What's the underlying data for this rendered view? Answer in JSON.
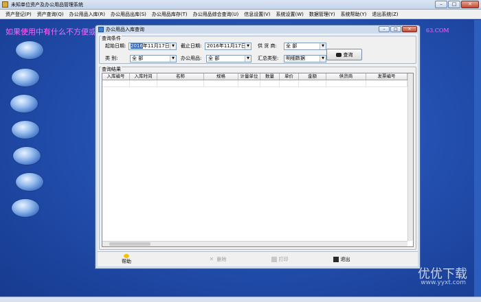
{
  "app": {
    "title": "未知单位资产及办公用品管理系统"
  },
  "window_controls": {
    "minimize": "–",
    "maximize": "□",
    "close": "✕"
  },
  "menu": [
    "资产登记(P)",
    "资产查询(Q)",
    "办公用品入库(R)",
    "办公用品出库(S)",
    "办公用品库存(T)",
    "办公用品综合查询(U)",
    "信息设置(V)",
    "系统设置(W)",
    "数据管理(Y)",
    "系统帮助(Y)",
    "退出系统(Z)"
  ],
  "marquee": {
    "text": "如果使用中有什么不方便或",
    "tail": "63.COM"
  },
  "dialog": {
    "title": "办公用品入库查询",
    "conditions": {
      "group_title": "查询条件",
      "start_date_label": "起始日期:",
      "start_date_sel": "2016",
      "start_date_rest": "年11月17日",
      "end_date_label": "截止日期:",
      "end_date": "2016年11月17日",
      "supplier_label": "供 货 商:",
      "supplier_value": "全    部",
      "category_label": "类    别:",
      "category_value": "全    部",
      "product_label": "办公用品:",
      "product_value": "全    部",
      "summary_label": "汇总类型:",
      "summary_value": "明细数据",
      "query_button": "查询"
    },
    "results": {
      "group_title": "查询结果",
      "columns": [
        "入库编号",
        "入库时间",
        "名称",
        "规格",
        "计量单位",
        "数量",
        "单价",
        "金额",
        "供货商",
        "发票编号"
      ]
    },
    "actions": {
      "help": "帮助",
      "delete": "删除",
      "print": "打印",
      "exit": "退出"
    }
  },
  "watermark": {
    "brand": "优优下载",
    "url": "www.yyxt.com"
  }
}
